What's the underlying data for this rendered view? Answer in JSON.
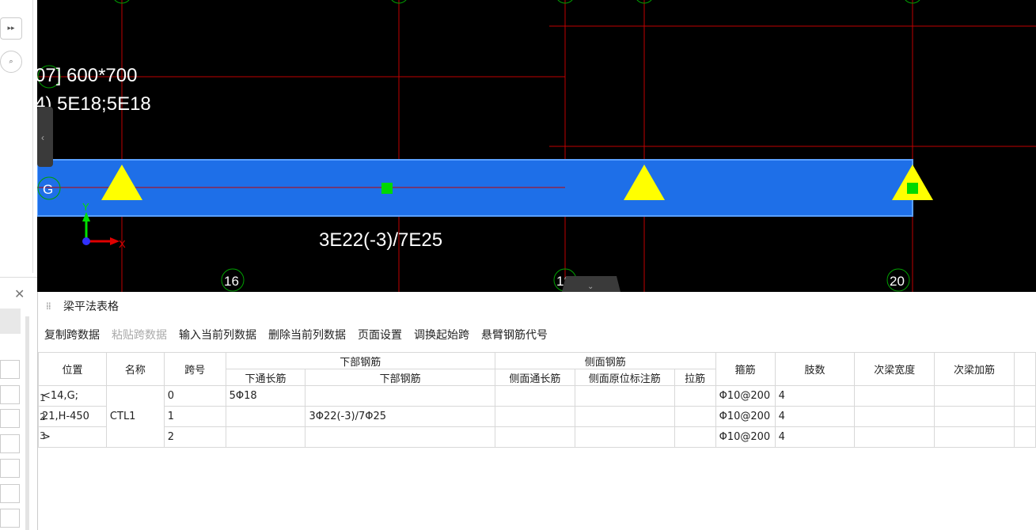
{
  "canvas": {
    "label_line1": "07] 600*700",
    "label_line2": "4) 5E18;5E18",
    "rebar_label": "3E22(-3)/7E25",
    "axis_g": "G",
    "axis_16": "16",
    "axis_18": "18",
    "axis_20": "20",
    "axis_y": "Y",
    "axis_x": "X",
    "colors": {
      "beam": "#1e6fe8",
      "grid": "#c00000",
      "support": "#ffff00",
      "node": "#00d800"
    }
  },
  "panel": {
    "title": "梁平法表格",
    "toolbar": [
      {
        "label": "复制跨数据",
        "enabled": true
      },
      {
        "label": "粘贴跨数据",
        "enabled": false
      },
      {
        "label": "输入当前列数据",
        "enabled": true
      },
      {
        "label": "删除当前列数据",
        "enabled": true
      },
      {
        "label": "页面设置",
        "enabled": true
      },
      {
        "label": "调换起始跨",
        "enabled": true
      },
      {
        "label": "悬臂钢筋代号",
        "enabled": true
      }
    ],
    "headers": {
      "position": "位置",
      "name": "名称",
      "span": "跨号",
      "bottom_group": "下部钢筋",
      "bottom_through": "下通长筋",
      "bottom_rebar": "下部钢筋",
      "side_group": "侧面钢筋",
      "side_through": "侧面通长筋",
      "side_annot": "侧面原位标注筋",
      "tie": "拉筋",
      "stirrup": "箍筋",
      "legs": "肢数",
      "sec_width": "次梁宽度",
      "sec_add": "次梁加筋"
    },
    "rows": [
      {
        "num": "1",
        "position": "<14,G;",
        "name": "",
        "span": "0",
        "bottom_through": "5Φ18",
        "bottom_rebar": "",
        "stirrup": "Φ10@200",
        "legs": "4"
      },
      {
        "num": "2",
        "position": "21,H-450",
        "name": "CTL1",
        "span": "1",
        "bottom_through": "",
        "bottom_rebar": "3Φ22(-3)/7Φ25",
        "stirrup": "Φ10@200",
        "legs": "4"
      },
      {
        "num": "3",
        "position": ">",
        "name": "",
        "span": "2",
        "bottom_through": "",
        "bottom_rebar": "",
        "stirrup": "Φ10@200",
        "legs": "4"
      }
    ]
  }
}
